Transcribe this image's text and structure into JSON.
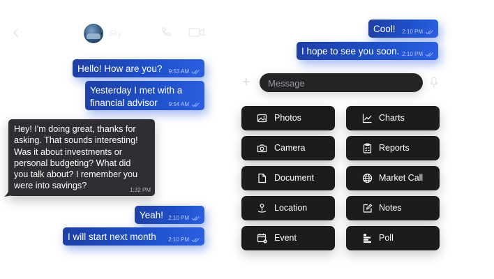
{
  "header": {
    "contact_name": "Sky"
  },
  "messages": [
    {
      "text_lines": [
        "Hello! How are you?"
      ],
      "time": "9:53 AM"
    },
    {
      "text_lines": [
        "Yesterday I met with a",
        "financial advisor"
      ],
      "time": "9:54 AM"
    },
    {
      "text_lines": [
        "Hey! I'm doing great, thanks for",
        "asking. That sounds interesting!",
        "Was it about investments or",
        "personal budgeting? What did",
        "you talk about? I remember you",
        "were into savings?"
      ],
      "time": "1:32 PM"
    },
    {
      "text_lines": [
        "Yeah!"
      ],
      "time": "2:10 PM"
    },
    {
      "text_lines": [
        "I will start next month"
      ],
      "time": "2:10 PM"
    },
    {
      "text_lines": [
        "Cool!"
      ],
      "time": "2:10 PM"
    },
    {
      "text_lines": [
        "I hope to see you soon."
      ],
      "time": "2:10 PM"
    }
  ],
  "composer": {
    "placeholder": "Message"
  },
  "attachments": {
    "left": [
      {
        "label": "Photos",
        "icon": "image-icon"
      },
      {
        "label": "Camera",
        "icon": "camera-icon"
      },
      {
        "label": "Document",
        "icon": "document-icon"
      },
      {
        "label": "Location",
        "icon": "location-pin-icon"
      },
      {
        "label": "Event",
        "icon": "calendar-icon"
      }
    ],
    "right": [
      {
        "label": "Charts",
        "icon": "line-chart-icon"
      },
      {
        "label": "Reports",
        "icon": "clipboard-icon"
      },
      {
        "label": "Market Call",
        "icon": "globe-icon"
      },
      {
        "label": "Notes",
        "icon": "edit-note-icon"
      },
      {
        "label": "Poll",
        "icon": "poll-icon"
      }
    ]
  },
  "colors": {
    "outgoing_bubble": "#1e4fc8",
    "incoming_bubble": "#2f2f33",
    "attachment_button": "#1c1c1f",
    "read_ticks": "#8fb0ff"
  }
}
